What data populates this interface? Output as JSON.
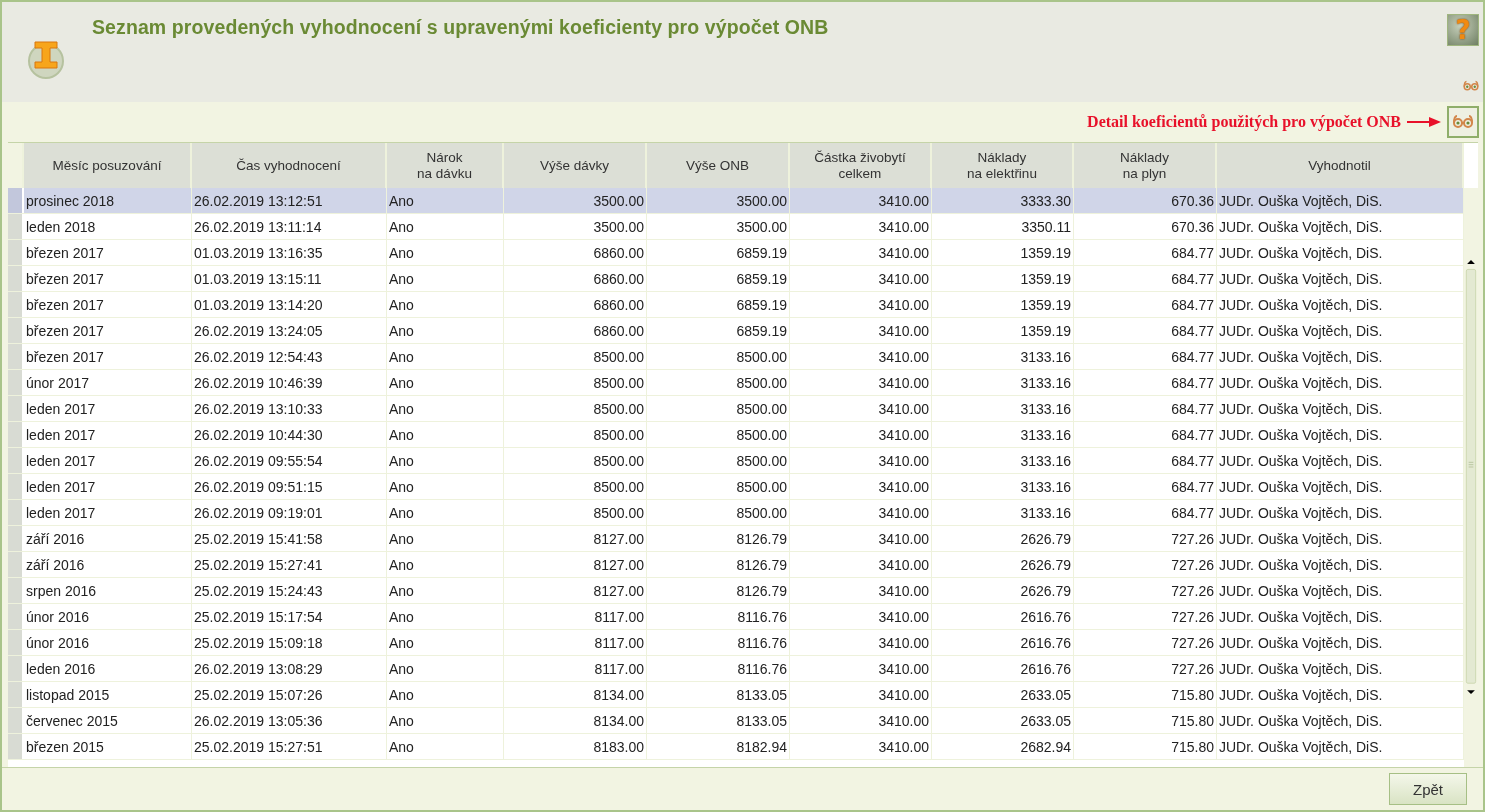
{
  "header": {
    "title": "Seznam provedených vyhodnocení s upravenými koeficienty pro výpočet ONB",
    "help_button": "?"
  },
  "detail_bar": {
    "annotation": "Detail koeficientů použitých pro výpočet ONB"
  },
  "table": {
    "columns": [
      {
        "label": "Měsíc posuzování",
        "kind": "text"
      },
      {
        "label": "Čas vyhodnocení",
        "kind": "text"
      },
      {
        "label": "Nárok\nna dávku",
        "kind": "text"
      },
      {
        "label": "Výše dávky",
        "kind": "number"
      },
      {
        "label": "Výše ONB",
        "kind": "number"
      },
      {
        "label": "Částka živobytí\ncelkem",
        "kind": "number"
      },
      {
        "label": "Náklady\nna elektřinu",
        "kind": "number"
      },
      {
        "label": "Náklady\nna plyn",
        "kind": "number"
      },
      {
        "label": "Vyhodnotil",
        "kind": "text"
      }
    ],
    "rows": [
      {
        "selected": true,
        "cells": [
          "prosinec 2018",
          "26.02.2019 13:12:51",
          "Ano",
          "3500.00",
          "3500.00",
          "3410.00",
          "3333.30",
          "670.36",
          "JUDr. Ouška Vojtěch, DiS."
        ]
      },
      {
        "selected": false,
        "cells": [
          "leden 2018",
          "26.02.2019 13:11:14",
          "Ano",
          "3500.00",
          "3500.00",
          "3410.00",
          "3350.11",
          "670.36",
          "JUDr. Ouška Vojtěch, DiS."
        ]
      },
      {
        "selected": false,
        "cells": [
          "březen 2017",
          "01.03.2019 13:16:35",
          "Ano",
          "6860.00",
          "6859.19",
          "3410.00",
          "1359.19",
          "684.77",
          "JUDr. Ouška Vojtěch, DiS."
        ]
      },
      {
        "selected": false,
        "cells": [
          "březen 2017",
          "01.03.2019 13:15:11",
          "Ano",
          "6860.00",
          "6859.19",
          "3410.00",
          "1359.19",
          "684.77",
          "JUDr. Ouška Vojtěch, DiS."
        ]
      },
      {
        "selected": false,
        "cells": [
          "březen 2017",
          "01.03.2019 13:14:20",
          "Ano",
          "6860.00",
          "6859.19",
          "3410.00",
          "1359.19",
          "684.77",
          "JUDr. Ouška Vojtěch, DiS."
        ]
      },
      {
        "selected": false,
        "cells": [
          "březen 2017",
          "26.02.2019 13:24:05",
          "Ano",
          "6860.00",
          "6859.19",
          "3410.00",
          "1359.19",
          "684.77",
          "JUDr. Ouška Vojtěch, DiS."
        ]
      },
      {
        "selected": false,
        "cells": [
          "březen 2017",
          "26.02.2019 12:54:43",
          "Ano",
          "8500.00",
          "8500.00",
          "3410.00",
          "3133.16",
          "684.77",
          "JUDr. Ouška Vojtěch, DiS."
        ]
      },
      {
        "selected": false,
        "cells": [
          "únor 2017",
          "26.02.2019 10:46:39",
          "Ano",
          "8500.00",
          "8500.00",
          "3410.00",
          "3133.16",
          "684.77",
          "JUDr. Ouška Vojtěch, DiS."
        ]
      },
      {
        "selected": false,
        "cells": [
          "leden 2017",
          "26.02.2019 13:10:33",
          "Ano",
          "8500.00",
          "8500.00",
          "3410.00",
          "3133.16",
          "684.77",
          "JUDr. Ouška Vojtěch, DiS."
        ]
      },
      {
        "selected": false,
        "cells": [
          "leden 2017",
          "26.02.2019 10:44:30",
          "Ano",
          "8500.00",
          "8500.00",
          "3410.00",
          "3133.16",
          "684.77",
          "JUDr. Ouška Vojtěch, DiS."
        ]
      },
      {
        "selected": false,
        "cells": [
          "leden 2017",
          "26.02.2019 09:55:54",
          "Ano",
          "8500.00",
          "8500.00",
          "3410.00",
          "3133.16",
          "684.77",
          "JUDr. Ouška Vojtěch, DiS."
        ]
      },
      {
        "selected": false,
        "cells": [
          "leden 2017",
          "26.02.2019 09:51:15",
          "Ano",
          "8500.00",
          "8500.00",
          "3410.00",
          "3133.16",
          "684.77",
          "JUDr. Ouška Vojtěch, DiS."
        ]
      },
      {
        "selected": false,
        "cells": [
          "leden 2017",
          "26.02.2019 09:19:01",
          "Ano",
          "8500.00",
          "8500.00",
          "3410.00",
          "3133.16",
          "684.77",
          "JUDr. Ouška Vojtěch, DiS."
        ]
      },
      {
        "selected": false,
        "cells": [
          "září 2016",
          "25.02.2019 15:41:58",
          "Ano",
          "8127.00",
          "8126.79",
          "3410.00",
          "2626.79",
          "727.26",
          "JUDr. Ouška Vojtěch, DiS."
        ]
      },
      {
        "selected": false,
        "cells": [
          "září 2016",
          "25.02.2019 15:27:41",
          "Ano",
          "8127.00",
          "8126.79",
          "3410.00",
          "2626.79",
          "727.26",
          "JUDr. Ouška Vojtěch, DiS."
        ]
      },
      {
        "selected": false,
        "cells": [
          "srpen 2016",
          "25.02.2019 15:24:43",
          "Ano",
          "8127.00",
          "8126.79",
          "3410.00",
          "2626.79",
          "727.26",
          "JUDr. Ouška Vojtěch, DiS."
        ]
      },
      {
        "selected": false,
        "cells": [
          "únor 2016",
          "25.02.2019 15:17:54",
          "Ano",
          "8117.00",
          "8116.76",
          "3410.00",
          "2616.76",
          "727.26",
          "JUDr. Ouška Vojtěch, DiS."
        ]
      },
      {
        "selected": false,
        "cells": [
          "únor 2016",
          "25.02.2019 15:09:18",
          "Ano",
          "8117.00",
          "8116.76",
          "3410.00",
          "2616.76",
          "727.26",
          "JUDr. Ouška Vojtěch, DiS."
        ]
      },
      {
        "selected": false,
        "cells": [
          "leden 2016",
          "26.02.2019 13:08:29",
          "Ano",
          "8117.00",
          "8116.76",
          "3410.00",
          "2616.76",
          "727.26",
          "JUDr. Ouška Vojtěch, DiS."
        ]
      },
      {
        "selected": false,
        "cells": [
          "listopad 2015",
          "25.02.2019 15:07:26",
          "Ano",
          "8134.00",
          "8133.05",
          "3410.00",
          "2633.05",
          "715.80",
          "JUDr. Ouška Vojtěch, DiS."
        ]
      },
      {
        "selected": false,
        "cells": [
          "červenec 2015",
          "26.02.2019 13:05:36",
          "Ano",
          "8134.00",
          "8133.05",
          "3410.00",
          "2633.05",
          "715.80",
          "JUDr. Ouška Vojtěch, DiS."
        ]
      },
      {
        "selected": false,
        "cells": [
          "březen 2015",
          "25.02.2019 15:27:51",
          "Ano",
          "8183.00",
          "8182.94",
          "3410.00",
          "2682.94",
          "715.80",
          "JUDr. Ouška Vojtěch, DiS."
        ]
      }
    ]
  },
  "footer": {
    "back_button": "Zpět"
  }
}
